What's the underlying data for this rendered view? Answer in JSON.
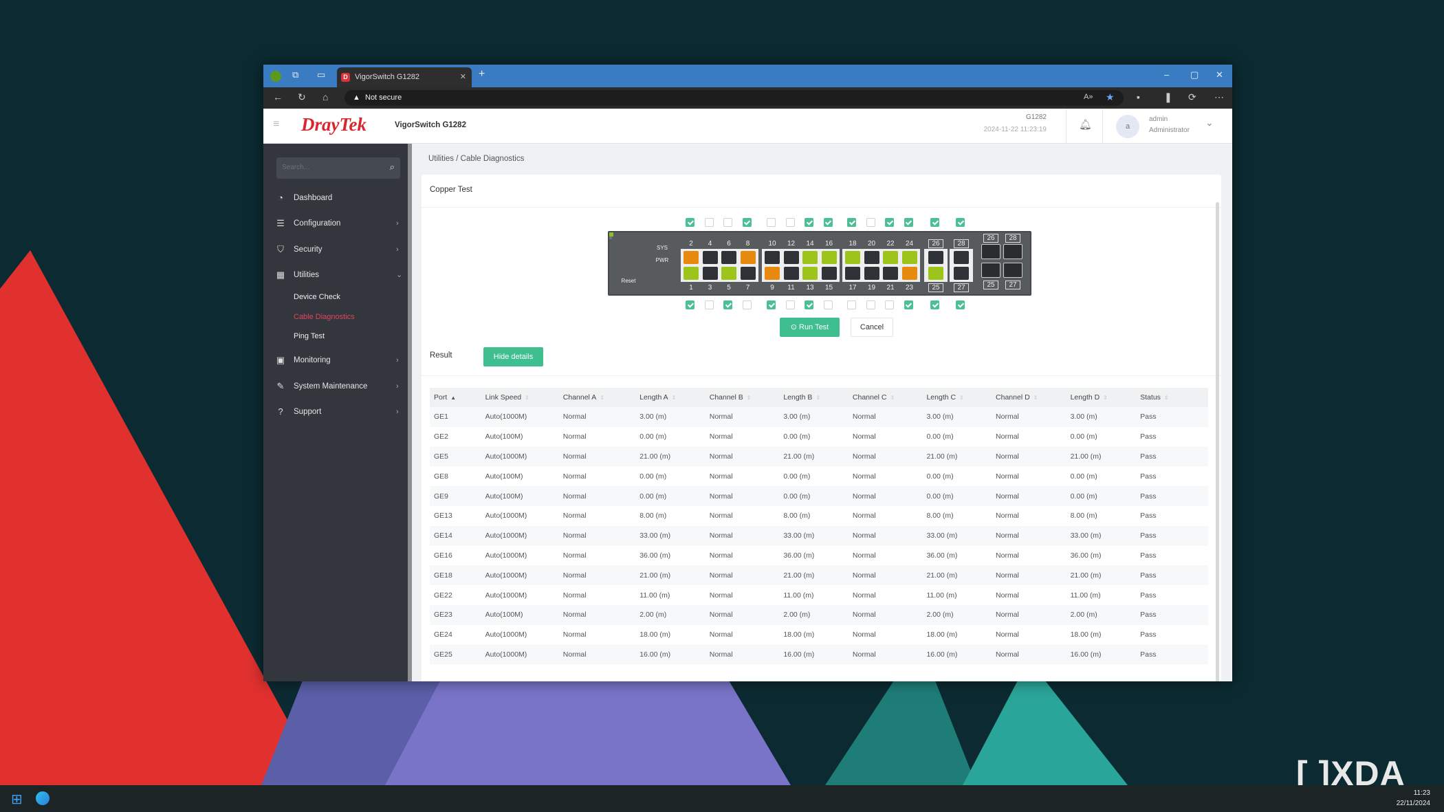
{
  "browser": {
    "tab_title": "VigorSwitch G1282",
    "security_label": "Not secure"
  },
  "header": {
    "logo": "DrayTek",
    "device_name": "VigorSwitch G1282",
    "model": "G1282",
    "datetime": "2024-11-22 11:23:19",
    "user_initial": "a",
    "user_name": "admin",
    "user_role": "Administrator"
  },
  "sidebar": {
    "search_placeholder": "Search...",
    "items": [
      {
        "label": "Dashboard",
        "icon": "gauge-icon",
        "glyph": "◔"
      },
      {
        "label": "Configuration",
        "icon": "sliders-icon",
        "glyph": "☰",
        "chevron": "›"
      },
      {
        "label": "Security",
        "icon": "shield-icon",
        "glyph": "⛉",
        "chevron": "›"
      },
      {
        "label": "Utilities",
        "icon": "grid-icon",
        "glyph": "▦",
        "chevron": "⌄"
      },
      {
        "label": "Monitoring",
        "icon": "monitor-icon",
        "glyph": "▣",
        "chevron": "›"
      },
      {
        "label": "System Maintenance",
        "icon": "wrench-icon",
        "glyph": "✎",
        "chevron": "›"
      },
      {
        "label": "Support",
        "icon": "help-icon",
        "glyph": "?",
        "chevron": "›"
      }
    ],
    "subitems": [
      {
        "label": "Device Check"
      },
      {
        "label": "Cable Diagnostics",
        "active": true
      },
      {
        "label": "Ping Test"
      }
    ]
  },
  "breadcrumb": {
    "parent": "Utilities /",
    "current": "Cable Diagnostics"
  },
  "card": {
    "title": "Copper Test",
    "run_label": "Run Test",
    "cancel_label": "Cancel",
    "result_label": "Result",
    "hide_details_label": "Hide details"
  },
  "switch": {
    "sys_label": "SYS",
    "pwr_label": "PWR",
    "reset_label": "Reset",
    "groups": [
      {
        "top": [
          2,
          4,
          6,
          8
        ],
        "bottom": [
          1,
          3,
          5,
          7
        ]
      },
      {
        "top": [
          10,
          12,
          14,
          16
        ],
        "bottom": [
          9,
          11,
          13,
          15
        ]
      },
      {
        "top": [
          18,
          20,
          22,
          24
        ],
        "bottom": [
          17,
          19,
          21,
          23
        ]
      },
      {
        "top": [
          26
        ],
        "bottom": [
          25
        ]
      },
      {
        "top": [
          28
        ],
        "bottom": [
          27
        ]
      }
    ],
    "sfp": {
      "top": [
        26,
        28
      ],
      "bottom": [
        25,
        27
      ]
    },
    "ports": {
      "1": "1000M",
      "2": "100M",
      "3": "down",
      "4": "down",
      "5": "1000M",
      "6": "down",
      "7": "down",
      "8": "100M",
      "9": "100M",
      "10": "down",
      "11": "down",
      "12": "down",
      "13": "1000M",
      "14": "1000M",
      "15": "down",
      "16": "1000M",
      "17": "down",
      "18": "1000M",
      "19": "down",
      "20": "down",
      "21": "down",
      "22": "1000M",
      "23": "100M",
      "24": "1000M",
      "25": "1000M",
      "26": "down",
      "27": "down",
      "28": "down"
    },
    "selected": [
      1,
      2,
      5,
      8,
      9,
      13,
      14,
      16,
      18,
      22,
      23,
      24,
      25,
      26,
      27,
      28
    ],
    "colors": {
      "1000M": "#9dc41b",
      "100M": "#e98a10",
      "down": "#2f3338"
    }
  },
  "table": {
    "columns": [
      "Port",
      "Link Speed",
      "Channel A",
      "Length A",
      "Channel B",
      "Length B",
      "Channel C",
      "Length C",
      "Channel D",
      "Length D",
      "Status"
    ],
    "rows": [
      [
        "GE1",
        "Auto(1000M)",
        "Normal",
        "3.00 (m)",
        "Normal",
        "3.00 (m)",
        "Normal",
        "3.00 (m)",
        "Normal",
        "3.00 (m)",
        "Pass"
      ],
      [
        "GE2",
        "Auto(100M)",
        "Normal",
        "0.00 (m)",
        "Normal",
        "0.00 (m)",
        "Normal",
        "0.00 (m)",
        "Normal",
        "0.00 (m)",
        "Pass"
      ],
      [
        "GE5",
        "Auto(1000M)",
        "Normal",
        "21.00 (m)",
        "Normal",
        "21.00 (m)",
        "Normal",
        "21.00 (m)",
        "Normal",
        "21.00 (m)",
        "Pass"
      ],
      [
        "GE8",
        "Auto(100M)",
        "Normal",
        "0.00 (m)",
        "Normal",
        "0.00 (m)",
        "Normal",
        "0.00 (m)",
        "Normal",
        "0.00 (m)",
        "Pass"
      ],
      [
        "GE9",
        "Auto(100M)",
        "Normal",
        "0.00 (m)",
        "Normal",
        "0.00 (m)",
        "Normal",
        "0.00 (m)",
        "Normal",
        "0.00 (m)",
        "Pass"
      ],
      [
        "GE13",
        "Auto(1000M)",
        "Normal",
        "8.00 (m)",
        "Normal",
        "8.00 (m)",
        "Normal",
        "8.00 (m)",
        "Normal",
        "8.00 (m)",
        "Pass"
      ],
      [
        "GE14",
        "Auto(1000M)",
        "Normal",
        "33.00 (m)",
        "Normal",
        "33.00 (m)",
        "Normal",
        "33.00 (m)",
        "Normal",
        "33.00 (m)",
        "Pass"
      ],
      [
        "GE16",
        "Auto(1000M)",
        "Normal",
        "36.00 (m)",
        "Normal",
        "36.00 (m)",
        "Normal",
        "36.00 (m)",
        "Normal",
        "36.00 (m)",
        "Pass"
      ],
      [
        "GE18",
        "Auto(1000M)",
        "Normal",
        "21.00 (m)",
        "Normal",
        "21.00 (m)",
        "Normal",
        "21.00 (m)",
        "Normal",
        "21.00 (m)",
        "Pass"
      ],
      [
        "GE22",
        "Auto(1000M)",
        "Normal",
        "11.00 (m)",
        "Normal",
        "11.00 (m)",
        "Normal",
        "11.00 (m)",
        "Normal",
        "11.00 (m)",
        "Pass"
      ],
      [
        "GE23",
        "Auto(100M)",
        "Normal",
        "2.00 (m)",
        "Normal",
        "2.00 (m)",
        "Normal",
        "2.00 (m)",
        "Normal",
        "2.00 (m)",
        "Pass"
      ],
      [
        "GE24",
        "Auto(1000M)",
        "Normal",
        "18.00 (m)",
        "Normal",
        "18.00 (m)",
        "Normal",
        "18.00 (m)",
        "Normal",
        "18.00 (m)",
        "Pass"
      ],
      [
        "GE25",
        "Auto(1000M)",
        "Normal",
        "16.00 (m)",
        "Normal",
        "16.00 (m)",
        "Normal",
        "16.00 (m)",
        "Normal",
        "16.00 (m)",
        "Pass"
      ]
    ]
  },
  "taskbar": {
    "time": "11:23",
    "date": "22/11/2024"
  },
  "watermark": "XDA",
  "colors": {
    "accent": "#4cbf95",
    "brand_red": "#d9262e",
    "active_menu": "#e2455a",
    "sidebar": "#33363d"
  }
}
